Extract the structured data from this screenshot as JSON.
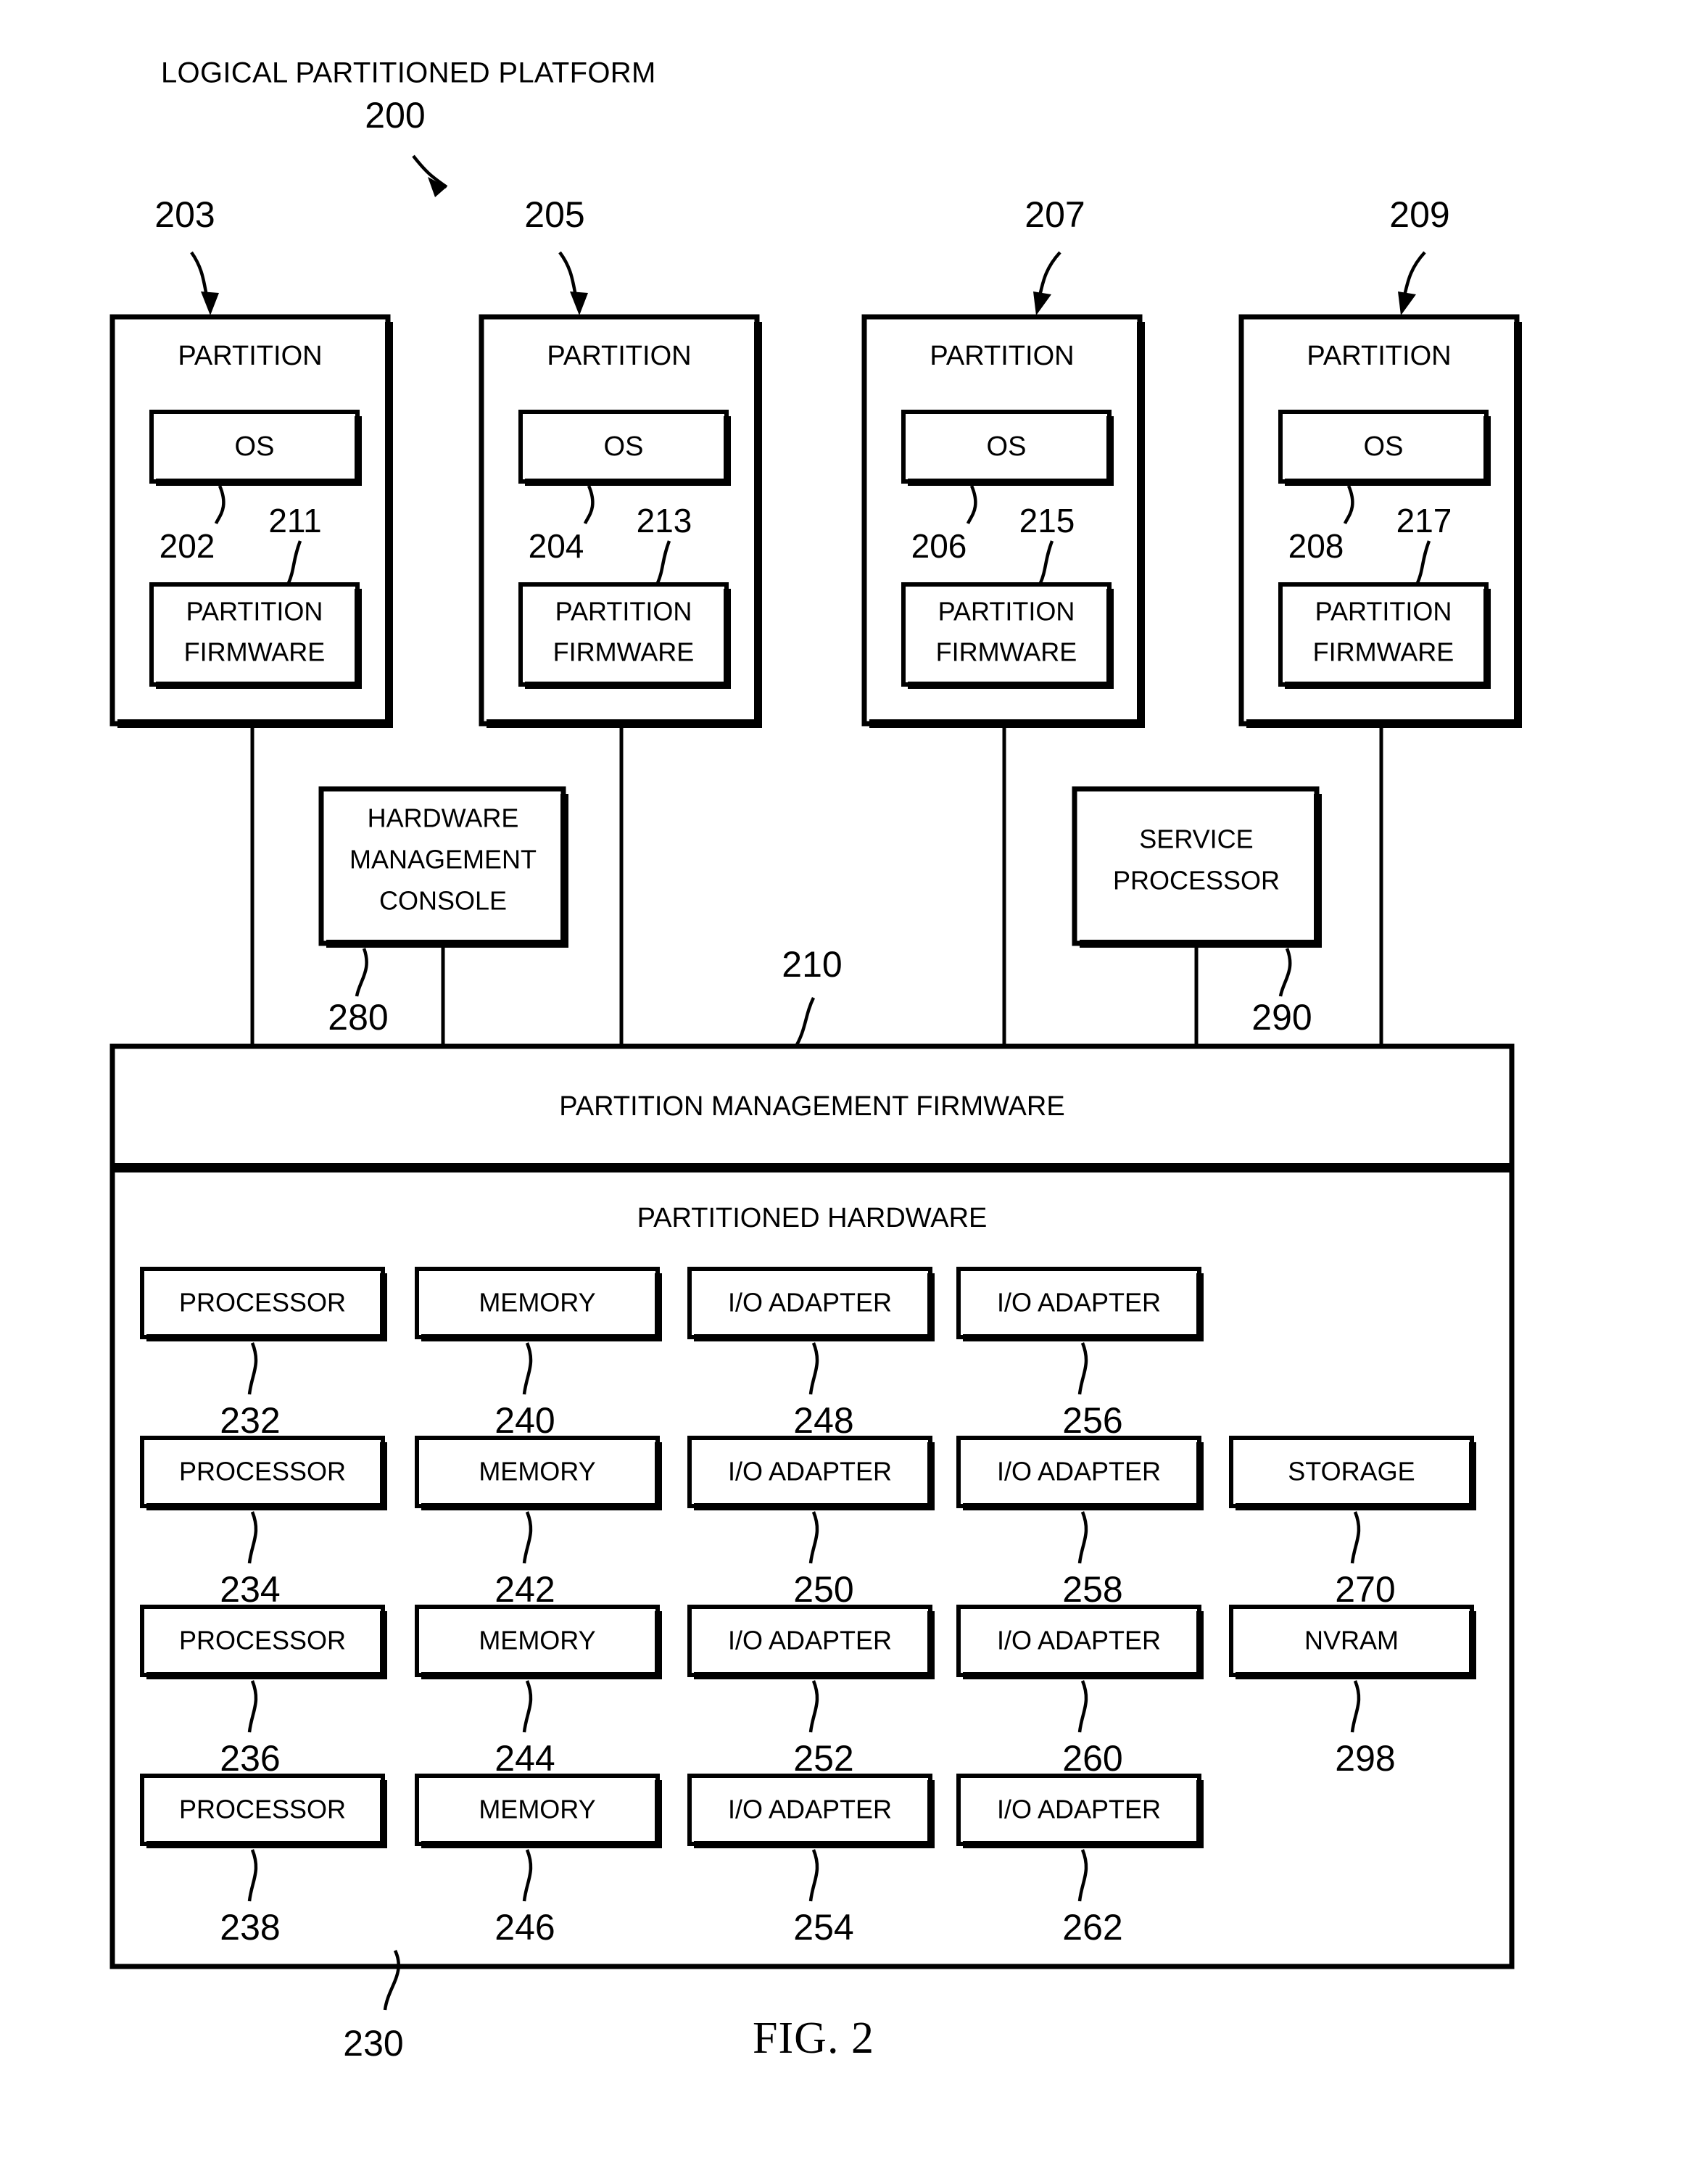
{
  "figure": {
    "title": "LOGICAL PARTITIONED PLATFORM",
    "title_ref": "200",
    "caption": "FIG. 2"
  },
  "partitions": [
    {
      "ref": "203",
      "label": "PARTITION",
      "os_label": "OS",
      "os_ref": "202",
      "fw_label_line1": "PARTITION",
      "fw_label_line2": "FIRMWARE",
      "fw_ref": "211"
    },
    {
      "ref": "205",
      "label": "PARTITION",
      "os_label": "OS",
      "os_ref": "204",
      "fw_label_line1": "PARTITION",
      "fw_label_line2": "FIRMWARE",
      "fw_ref": "213"
    },
    {
      "ref": "207",
      "label": "PARTITION",
      "os_label": "OS",
      "os_ref": "206",
      "fw_label_line1": "PARTITION",
      "fw_label_line2": "FIRMWARE",
      "fw_ref": "215"
    },
    {
      "ref": "209",
      "label": "PARTITION",
      "os_label": "OS",
      "os_ref": "208",
      "fw_label_line1": "PARTITION",
      "fw_label_line2": "FIRMWARE",
      "fw_ref": "217"
    }
  ],
  "hmc": {
    "line1": "HARDWARE",
    "line2": "MANAGEMENT",
    "line3": "CONSOLE",
    "ref": "280"
  },
  "service_processor": {
    "line1": "SERVICE",
    "line2": "PROCESSOR",
    "ref": "290"
  },
  "partition_management_firmware": {
    "label": "PARTITION MANAGEMENT FIRMWARE",
    "ref": "210"
  },
  "partitioned_hardware": {
    "label": "PARTITIONED HARDWARE",
    "ref": "230",
    "rows": [
      [
        {
          "label": "PROCESSOR",
          "ref": "232"
        },
        {
          "label": "MEMORY",
          "ref": "240"
        },
        {
          "label": "I/O ADAPTER",
          "ref": "248"
        },
        {
          "label": "I/O ADAPTER",
          "ref": "256"
        }
      ],
      [
        {
          "label": "PROCESSOR",
          "ref": "234"
        },
        {
          "label": "MEMORY",
          "ref": "242"
        },
        {
          "label": "I/O ADAPTER",
          "ref": "250"
        },
        {
          "label": "I/O ADAPTER",
          "ref": "258"
        },
        {
          "label": "STORAGE",
          "ref": "270"
        }
      ],
      [
        {
          "label": "PROCESSOR",
          "ref": "236"
        },
        {
          "label": "MEMORY",
          "ref": "244"
        },
        {
          "label": "I/O ADAPTER",
          "ref": "252"
        },
        {
          "label": "I/O ADAPTER",
          "ref": "260"
        },
        {
          "label": "NVRAM",
          "ref": "298"
        }
      ],
      [
        {
          "label": "PROCESSOR",
          "ref": "238"
        },
        {
          "label": "MEMORY",
          "ref": "246"
        },
        {
          "label": "I/O ADAPTER",
          "ref": "254"
        },
        {
          "label": "I/O ADAPTER",
          "ref": "262"
        }
      ]
    ]
  },
  "colors": {
    "ink": "#000000",
    "paper": "#ffffff"
  }
}
